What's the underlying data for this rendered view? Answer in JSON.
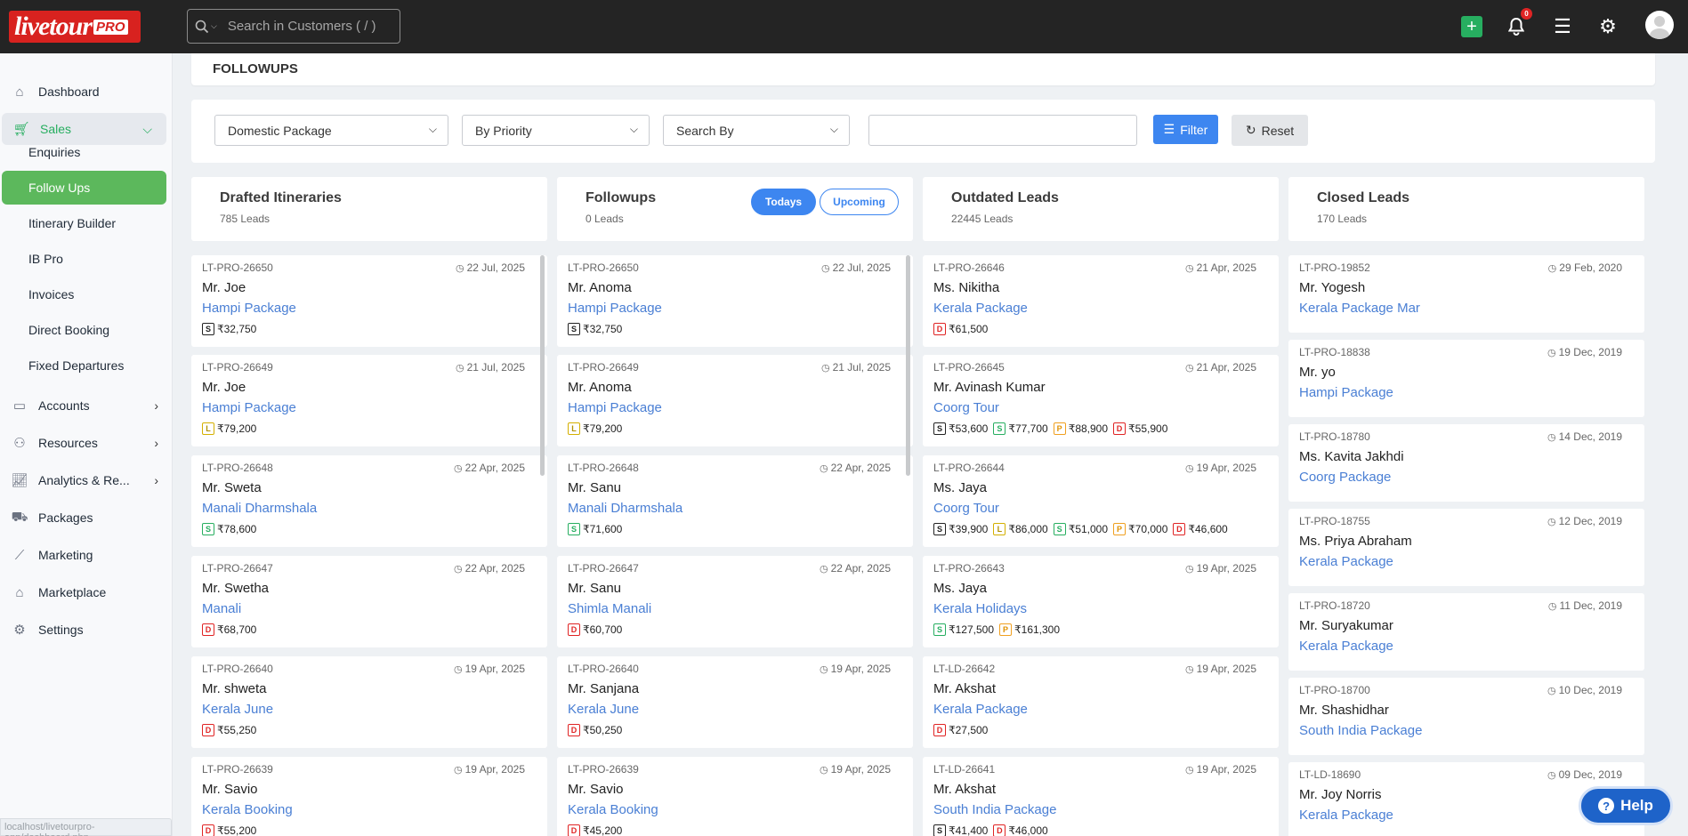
{
  "app": {
    "logo_text": "livetour",
    "logo_badge": "PRO",
    "notification_count": "0"
  },
  "search": {
    "placeholder": "Search in Customers ( / )"
  },
  "nav": {
    "dashboard": "Dashboard",
    "sales": "Sales",
    "sales_sub": [
      "Enquiries",
      "Follow Ups",
      "Itinerary Builder",
      "IB Pro",
      "Invoices",
      "Direct Booking",
      "Fixed Departures"
    ],
    "accounts": "Accounts",
    "resources": "Resources",
    "analytics": "Analytics & Re...",
    "packages": "Packages",
    "marketing": "Marketing",
    "marketplace": "Marketplace",
    "settings": "Settings"
  },
  "status_url": "localhost/livetourpro-app/dashboard.php",
  "page": {
    "title": "FOLLOWUPS"
  },
  "filters": {
    "package_type": "Domestic Package",
    "priority": "By Priority",
    "search_by": "Search By",
    "filter_label": "Filter",
    "reset_label": "Reset"
  },
  "toggle": {
    "todays": "Todays",
    "upcoming": "Upcoming"
  },
  "colors": {
    "accent": "#3d86f0",
    "sales_green": "#27ae60",
    "active_green": "#5cb85c",
    "topbar": "#242424",
    "link": "#4a7fd4"
  },
  "columns": [
    {
      "title": "Drafted Itineraries",
      "count": "785 Leads",
      "cards": [
        {
          "id": "LT-PRO-26650",
          "date": "22 Jul, 2025",
          "name": "Mr. Joe",
          "package": "Hampi Package",
          "prices": [
            {
              "tag": "S",
              "amount": "₹32,750"
            }
          ]
        },
        {
          "id": "LT-PRO-26649",
          "date": "21 Jul, 2025",
          "name": "Mr. Joe",
          "package": "Hampi Package",
          "prices": [
            {
              "tag": "L",
              "amount": "₹79,200"
            }
          ]
        },
        {
          "id": "LT-PRO-26648",
          "date": "22 Apr, 2025",
          "name": "Mr. Sweta",
          "package": "Manali Dharmshala",
          "prices": [
            {
              "tag": "S2",
              "amount": "₹78,600"
            }
          ]
        },
        {
          "id": "LT-PRO-26647",
          "date": "22 Apr, 2025",
          "name": "Mr. Swetha",
          "package": "Manali",
          "prices": [
            {
              "tag": "D",
              "amount": "₹68,700"
            }
          ]
        },
        {
          "id": "LT-PRO-26640",
          "date": "19 Apr, 2025",
          "name": "Mr. shweta",
          "package": "Kerala June",
          "prices": [
            {
              "tag": "D",
              "amount": "₹55,250"
            }
          ]
        },
        {
          "id": "LT-PRO-26639",
          "date": "19 Apr, 2025",
          "name": "Mr. Savio",
          "package": "Kerala Booking",
          "prices": [
            {
              "tag": "D",
              "amount": "₹55,200"
            }
          ]
        }
      ]
    },
    {
      "title": "Followups",
      "count": "0 Leads",
      "cards": [
        {
          "id": "LT-PRO-26650",
          "date": "22 Jul, 2025",
          "name": "Mr. Anoma",
          "package": "Hampi Package",
          "prices": [
            {
              "tag": "S",
              "amount": "₹32,750"
            }
          ]
        },
        {
          "id": "LT-PRO-26649",
          "date": "21 Jul, 2025",
          "name": "Mr. Anoma",
          "package": "Hampi Package",
          "prices": [
            {
              "tag": "L",
              "amount": "₹79,200"
            }
          ]
        },
        {
          "id": "LT-PRO-26648",
          "date": "22 Apr, 2025",
          "name": "Mr. Sanu",
          "package": "Manali Dharmshala",
          "prices": [
            {
              "tag": "S2",
              "amount": "₹71,600"
            }
          ]
        },
        {
          "id": "LT-PRO-26647",
          "date": "22 Apr, 2025",
          "name": "Mr. Sanu",
          "package": "Shimla Manali",
          "prices": [
            {
              "tag": "D",
              "amount": "₹60,700"
            }
          ]
        },
        {
          "id": "LT-PRO-26640",
          "date": "19 Apr, 2025",
          "name": "Mr. Sanjana",
          "package": "Kerala June",
          "prices": [
            {
              "tag": "D",
              "amount": "₹50,250"
            }
          ]
        },
        {
          "id": "LT-PRO-26639",
          "date": "19 Apr, 2025",
          "name": "Mr. Savio",
          "package": "Kerala Booking",
          "prices": [
            {
              "tag": "D",
              "amount": "₹45,200"
            }
          ]
        }
      ]
    },
    {
      "title": "Outdated Leads",
      "count": "22445 Leads",
      "cards": [
        {
          "id": "LT-PRO-26646",
          "date": "21 Apr, 2025",
          "name": "Ms. Nikitha",
          "package": "Kerala Package",
          "prices": [
            {
              "tag": "D",
              "amount": "₹61,500"
            }
          ]
        },
        {
          "id": "LT-PRO-26645",
          "date": "21 Apr, 2025",
          "name": "Mr. Avinash Kumar",
          "package": "Coorg Tour",
          "prices": [
            {
              "tag": "S",
              "amount": "₹53,600"
            },
            {
              "tag": "S2",
              "amount": "₹77,700"
            },
            {
              "tag": "P",
              "amount": "₹88,900"
            },
            {
              "tag": "D",
              "amount": "₹55,900"
            }
          ]
        },
        {
          "id": "LT-PRO-26644",
          "date": "19 Apr, 2025",
          "name": "Ms. Jaya",
          "package": "Coorg Tour",
          "prices": [
            {
              "tag": "S",
              "amount": "₹39,900"
            },
            {
              "tag": "L",
              "amount": "₹86,000"
            },
            {
              "tag": "S2",
              "amount": "₹51,000"
            },
            {
              "tag": "P",
              "amount": "₹70,000"
            },
            {
              "tag": "D",
              "amount": "₹46,600"
            }
          ]
        },
        {
          "id": "LT-PRO-26643",
          "date": "19 Apr, 2025",
          "name": "Ms. Jaya",
          "package": "Kerala Holidays",
          "prices": [
            {
              "tag": "S2",
              "amount": "₹127,500"
            },
            {
              "tag": "P",
              "amount": "₹161,300"
            }
          ]
        },
        {
          "id": "LT-LD-26642",
          "date": "19 Apr, 2025",
          "name": "Mr. Akshat",
          "package": "Kerala Package",
          "prices": [
            {
              "tag": "D",
              "amount": "₹27,500"
            }
          ]
        },
        {
          "id": "LT-LD-26641",
          "date": "19 Apr, 2025",
          "name": "Mr. Akshat",
          "package": "South India Package",
          "prices": [
            {
              "tag": "S",
              "amount": "₹41,400"
            },
            {
              "tag": "D",
              "amount": "₹46,000"
            }
          ]
        }
      ]
    },
    {
      "title": "Closed Leads",
      "count": "170 Leads",
      "cards": [
        {
          "id": "LT-PRO-19852",
          "date": "29 Feb, 2020",
          "name": "Mr. Yogesh",
          "package": "Kerala Package Mar",
          "prices": []
        },
        {
          "id": "LT-PRO-18838",
          "date": "19 Dec, 2019",
          "name": "Mr. yo",
          "package": "Hampi Package",
          "prices": []
        },
        {
          "id": "LT-PRO-18780",
          "date": "14 Dec, 2019",
          "name": "Ms. Kavita Jakhdi",
          "package": "Coorg Package",
          "prices": []
        },
        {
          "id": "LT-PRO-18755",
          "date": "12 Dec, 2019",
          "name": "Ms. Priya Abraham",
          "package": "Kerala Package",
          "prices": []
        },
        {
          "id": "LT-PRO-18720",
          "date": "11 Dec, 2019",
          "name": "Mr. Suryakumar",
          "package": "Kerala Package",
          "prices": []
        },
        {
          "id": "LT-PRO-18700",
          "date": "10 Dec, 2019",
          "name": "Mr. Shashidhar",
          "package": "South India Package",
          "prices": []
        },
        {
          "id": "LT-LD-18690",
          "date": "09 Dec, 2019",
          "name": "Mr. Joy Norris",
          "package": "Kerala Package",
          "prices": []
        }
      ]
    }
  ],
  "help": {
    "label": "Help"
  }
}
